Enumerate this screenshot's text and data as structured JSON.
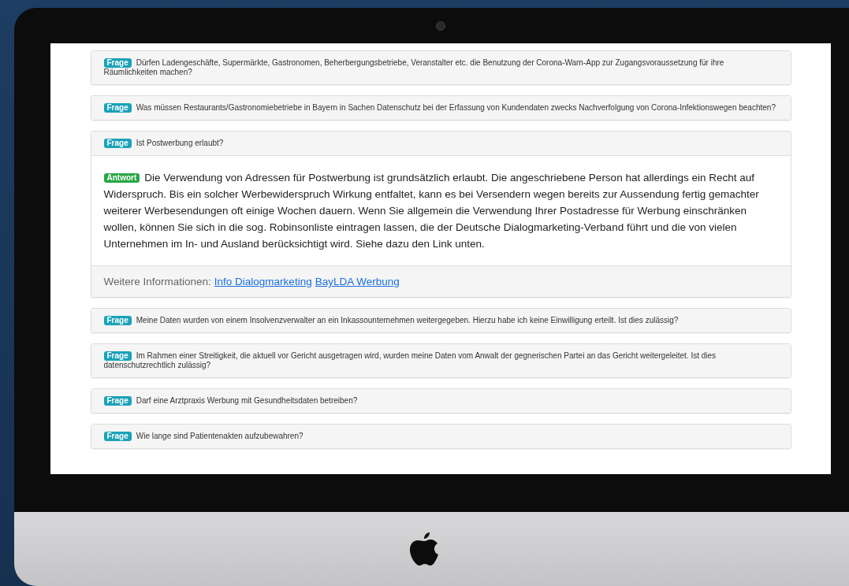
{
  "faq": [
    {
      "badge": "Frage",
      "question": "Dürfen Ladengeschäfte, Supermärkte, Gastronomen, Beherbergungsbetriebe, Veranstalter etc. die Benutzung der Corona-Warn-App zur Zugangsvoraussetzung für ihre Räumlichkeiten machen?",
      "expanded": false
    },
    {
      "badge": "Frage",
      "question": "Was müssen Restaurants/Gastronomiebetriebe in Bayern in Sachen Datenschutz bei der Erfassung von Kundendaten zwecks Nachverfolgung von Corona-Infektionswegen beachten?",
      "expanded": false
    },
    {
      "badge": "Frage",
      "question": "Ist Postwerbung erlaubt?",
      "expanded": true,
      "answer": {
        "badge": "Antwort",
        "text": "Die Verwendung von Adressen für Postwerbung ist grundsätzlich erlaubt. Die angeschriebene Person hat allerdings ein Recht auf Widerspruch. Bis ein solcher Werbewiderspruch Wirkung entfaltet, kann es bei Versendern wegen bereits zur Aussendung fertig gemachter weiterer Werbesendungen oft einige Wochen dauern. Wenn Sie allgemein die Verwendung Ihrer Postadresse für Werbung einschränken wollen, können Sie sich in die sog. Robinsonliste eintragen lassen, die der Deutsche Dialogmarketing-Verband führt und die von vielen Unternehmen im In- und Ausland berücksichtigt wird. Siehe dazu den Link unten."
      },
      "footer": {
        "label": "Weitere Informationen:",
        "links": [
          "Info Dialogmarketing",
          "BayLDA Werbung"
        ]
      }
    },
    {
      "badge": "Frage",
      "question": "Meine Daten wurden von einem Insolvenzverwalter an ein Inkassounternehmen weitergegeben. Hierzu habe ich keine Einwilligung erteilt. Ist dies zulässig?",
      "expanded": false
    },
    {
      "badge": "Frage",
      "question": "Im Rahmen einer Streitigkeit, die aktuell vor Gericht ausgetragen wird, wurden meine Daten vom Anwalt der gegnerischen Partei an das Gericht weitergeleitet. Ist dies datenschutzrechtlich zulässig?",
      "expanded": false
    },
    {
      "badge": "Frage",
      "question": "Darf eine Arztpraxis Werbung mit Gesundheitsdaten betreiben?",
      "expanded": false
    },
    {
      "badge": "Frage",
      "question": "Wie lange sind Patientenakten aufzubewahren?",
      "expanded": false
    }
  ]
}
